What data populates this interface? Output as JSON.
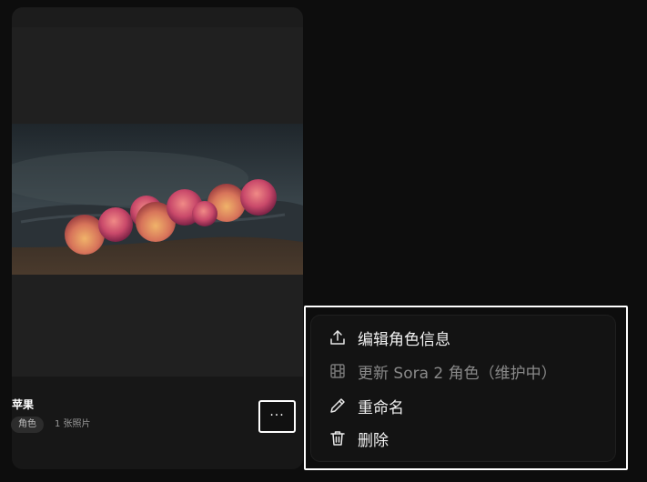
{
  "card": {
    "title": "苹果",
    "tag": "角色",
    "photo_count": "1 张照片",
    "more_label": "···"
  },
  "menu": {
    "items": [
      {
        "label": "编辑角色信息",
        "icon": "upload-icon",
        "disabled": false
      },
      {
        "label": "更新 Sora 2 角色（维护中）",
        "icon": "film-icon",
        "disabled": true
      },
      {
        "label": "重命名",
        "icon": "pencil-icon",
        "disabled": false
      },
      {
        "label": "删除",
        "icon": "trash-icon",
        "disabled": false
      }
    ]
  },
  "colors": {
    "background": "#0d0d0d",
    "card": "#191919",
    "menu": "#131313",
    "disabled_text": "#8a8a8a"
  }
}
